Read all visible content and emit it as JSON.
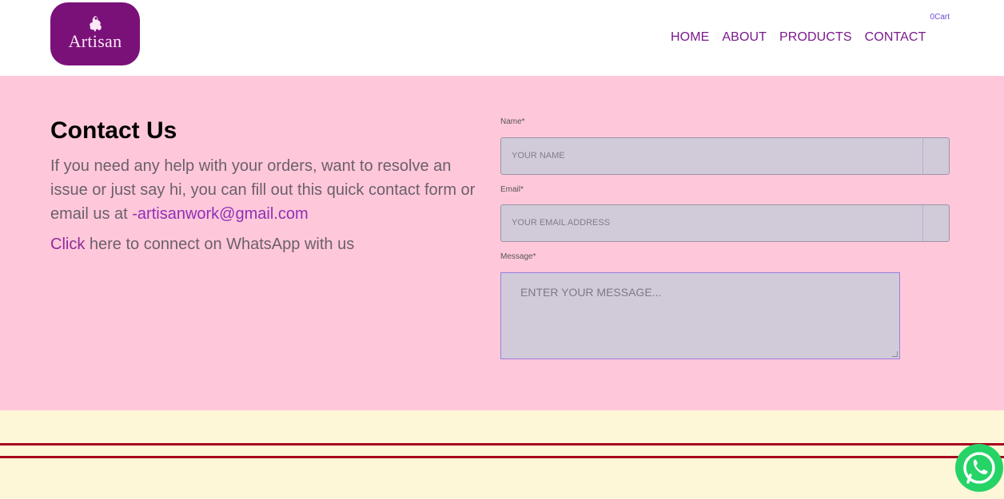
{
  "header": {
    "logo_text": "Artisan",
    "cart_label": "0Cart",
    "nav": [
      {
        "label": "HOME"
      },
      {
        "label": "ABOUT"
      },
      {
        "label": "PRODUCTS"
      },
      {
        "label": "CONTACT"
      }
    ]
  },
  "contact": {
    "title": "Contact Us",
    "intro_text": "If you need any help with your orders, want to resolve an issue or just say hi, you can fill out this quick contact form or email us at ",
    "email_link": "-artisanwork@gmail.com",
    "click_link": "Click",
    "whatsapp_text": " here to connect on WhatsApp with us"
  },
  "form": {
    "name_label": "Name*",
    "name_placeholder": "YOUR NAME",
    "email_label": "Email*",
    "email_placeholder": "YOUR EMAIL ADDRESS",
    "message_label": "Message*",
    "message_placeholder": "ENTER YOUR MESSAGE..."
  },
  "colors": {
    "brand_purple": "#7a1179",
    "contact_bg": "#ffc8da",
    "footer_bg": "#fdf7d8",
    "footer_lines": "#a8001e",
    "whatsapp_green": "#25d366"
  },
  "icons": {
    "logo_mark": "rider-icon",
    "floating_button": "whatsapp-icon"
  }
}
